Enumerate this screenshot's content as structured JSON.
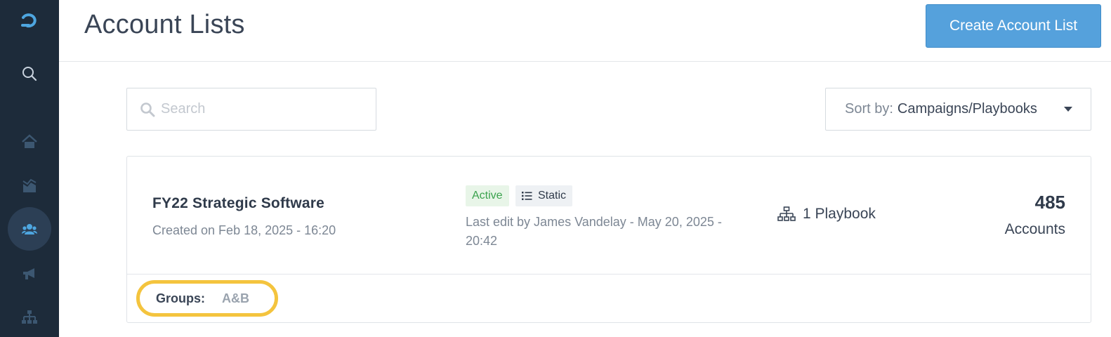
{
  "sidebar": {
    "items": [
      {
        "icon": "logo-icon",
        "active": false
      },
      {
        "icon": "search-icon",
        "active": false
      },
      {
        "icon": "home-icon",
        "active": false
      },
      {
        "icon": "analytics-icon",
        "active": false
      },
      {
        "icon": "users-icon",
        "active": true
      },
      {
        "icon": "megaphone-icon",
        "active": false
      },
      {
        "icon": "hierarchy-icon",
        "active": false
      }
    ]
  },
  "header": {
    "title": "Account Lists",
    "create_button": "Create Account List"
  },
  "toolbar": {
    "search_placeholder": "Search",
    "search_value": "",
    "sort_label": "Sort by:",
    "sort_value": "Campaigns/Playbooks"
  },
  "account_lists": [
    {
      "name": "FY22 Strategic Software",
      "created": "Created on Feb 18, 2025 - 16:20",
      "status": "Active",
      "type": "Static",
      "last_edit": "Last edit by James Vandelay - May 20, 2025 - 20:42",
      "playbooks": "1 Playbook",
      "accounts_count": "485",
      "accounts_label": "Accounts",
      "groups_label": "Groups:",
      "groups_value": "A&B"
    }
  ],
  "colors": {
    "sidebar_bg": "#1d2b3a",
    "accent": "#55a1dc",
    "active_badge": "#3aa24d",
    "highlight": "#f4c43e"
  }
}
